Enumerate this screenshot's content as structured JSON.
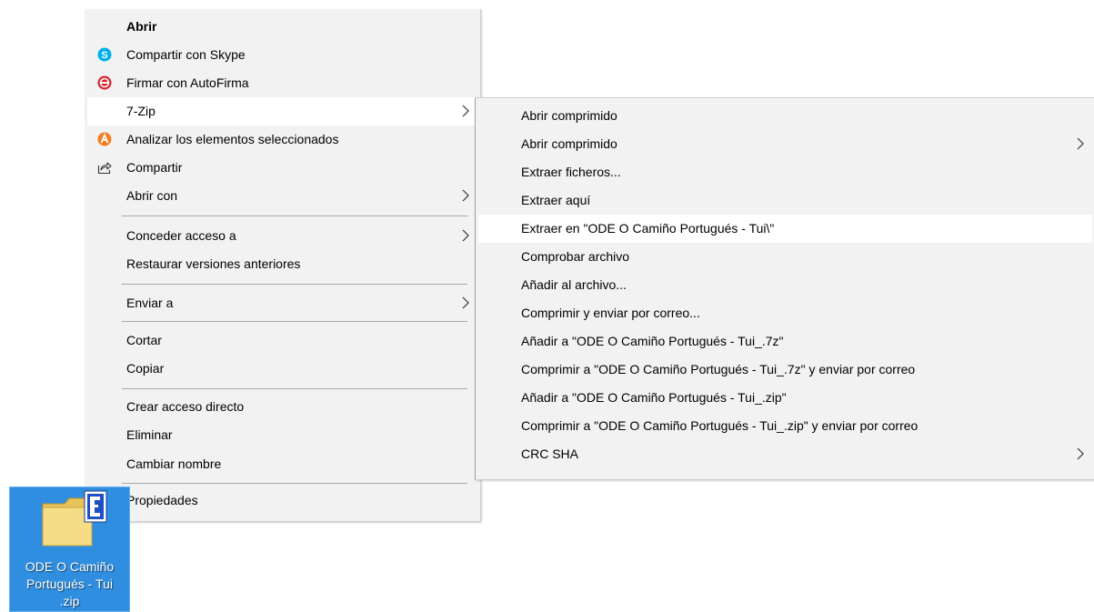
{
  "context_menu": {
    "items": [
      {
        "label": "Abrir",
        "bold": true
      },
      {
        "label": "Compartir con Skype",
        "icon": "skype-icon"
      },
      {
        "label": "Firmar con AutoFirma",
        "icon": "autofirma-icon"
      },
      {
        "label": "7-Zip",
        "submenu": true,
        "highlighted": true
      },
      {
        "label": "Analizar los elementos seleccionados",
        "icon": "avast-icon"
      },
      {
        "label": "Compartir",
        "icon": "share-icon"
      },
      {
        "label": "Abrir con",
        "submenu": true
      },
      {
        "label": "Conceder acceso a",
        "submenu": true
      },
      {
        "label": "Restaurar versiones anteriores"
      },
      {
        "label": "Enviar a",
        "submenu": true
      },
      {
        "label": "Cortar"
      },
      {
        "label": "Copiar"
      },
      {
        "label": "Crear acceso directo"
      },
      {
        "label": "Eliminar"
      },
      {
        "label": "Cambiar nombre"
      },
      {
        "label": "Propiedades"
      }
    ]
  },
  "submenu_7zip": {
    "items": [
      {
        "label": "Abrir comprimido"
      },
      {
        "label": "Abrir comprimido",
        "submenu": true
      },
      {
        "label": "Extraer ficheros..."
      },
      {
        "label": "Extraer aquí"
      },
      {
        "label": "Extraer en \"ODE O Camiño Portugués - Tui\\\"",
        "highlighted": true
      },
      {
        "label": "Comprobar archivo"
      },
      {
        "label": "Añadir al archivo..."
      },
      {
        "label": "Comprimir y enviar por correo..."
      },
      {
        "label": "Añadir a \"ODE O Camiño Portugués - Tui_.7z\""
      },
      {
        "label": "Comprimir a \"ODE O Camiño Portugués - Tui_.7z\" y enviar por correo"
      },
      {
        "label": "Añadir a \"ODE O Camiño Portugués - Tui_.zip\""
      },
      {
        "label": "Comprimir a \"ODE O Camiño Portugués - Tui_.zip\" y enviar por correo"
      },
      {
        "label": "CRC SHA",
        "submenu": true
      }
    ]
  },
  "desktop_icon": {
    "label_lines": [
      "ODE O Camiño",
      "Portugués - Tui",
      ".zip"
    ],
    "icon": "zip-folder-icon"
  },
  "colors": {
    "menu_bg": "#f2f2f2",
    "hover_bg": "#ffffff",
    "selection_blue": "#2f8ee0",
    "skype": "#00aff0",
    "autofirma": "#d9232d",
    "avast": "#f57c1f"
  }
}
